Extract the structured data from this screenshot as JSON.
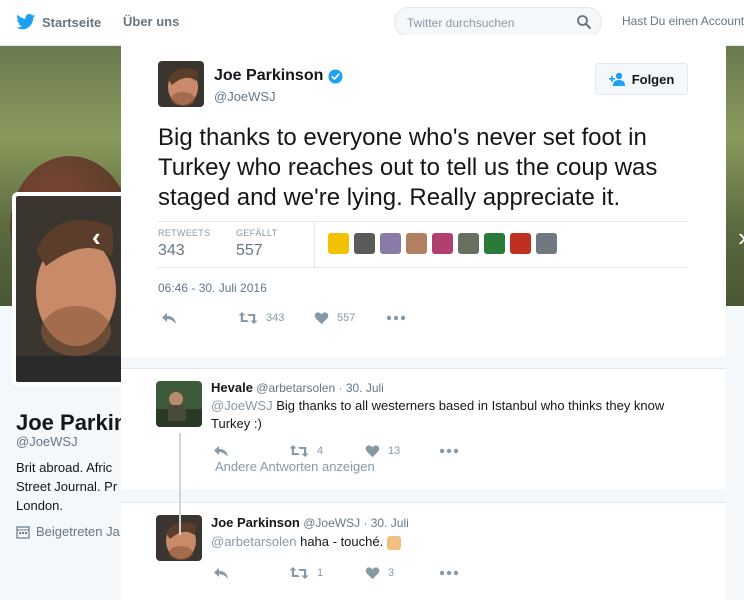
{
  "nav": {
    "home_label": "Startseite",
    "about_label": "Über uns",
    "search_placeholder": "Twitter durchsuchen",
    "login_text": "Hast Du einen Account?"
  },
  "profile_bg": {
    "name": "Joe Parkin",
    "handle": "@JoeWSJ",
    "bio": "Brit abroad. Afric Street Journal. Pr London.",
    "joined": "Beigetreten Ja"
  },
  "tweet": {
    "author_name": "Joe Parkinson",
    "author_handle": "@JoeWSJ",
    "follow_label": "Folgen",
    "text": "Big thanks to everyone who's never set foot in Turkey who reaches out to tell us the coup was staged and we're lying. Really appreciate it.",
    "retweets_label": "RETWEETS",
    "retweets": "343",
    "likes_label": "GEFÄLLT",
    "likes": "557",
    "timestamp": "06:46 - 30. Juli 2016",
    "action_retweets": "343",
    "action_likes": "557",
    "colors": {
      "accent": "#1da1f2",
      "verified": "#1da1f2"
    },
    "likers": [
      {
        "icon": "sun-flower-avatar",
        "color": "#f2c200"
      },
      {
        "icon": "portrait-avatar",
        "color": "#5a5a5a"
      },
      {
        "icon": "photo-avatar",
        "color": "#8a7aa8"
      },
      {
        "icon": "face-avatar",
        "color": "#b08060"
      },
      {
        "icon": "portrait-avatar",
        "color": "#b04070"
      },
      {
        "icon": "group-avatar",
        "color": "#6a7060"
      },
      {
        "icon": "flag-avatar",
        "color": "#2a7a3a"
      },
      {
        "icon": "logo-avatar",
        "color": "#c03020"
      },
      {
        "icon": "man-avatar",
        "color": "#707880"
      }
    ]
  },
  "replies": [
    {
      "name": "Hevale",
      "handle": "@arbetarsolen",
      "date": "30. Juli",
      "mention": "@JoeWSJ",
      "text": "Big thanks to all westerners based in Istanbul who thinks they know Turkey :)",
      "retweets": "4",
      "likes": "13"
    },
    {
      "name": "Joe Parkinson",
      "handle": "@JoeWSJ",
      "date": "30. Juli",
      "mention": "@arbetarsolen",
      "text": "haha - touché.",
      "retweets": "1",
      "likes": "3"
    }
  ],
  "more_replies_label": "Andere Antworten anzeigen"
}
